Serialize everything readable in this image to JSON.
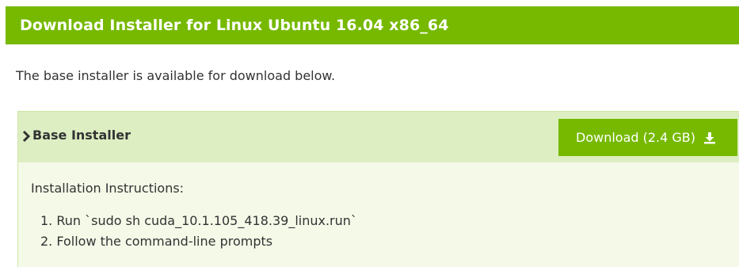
{
  "header": {
    "title": "Download Installer for Linux Ubuntu 16.04 x86_64"
  },
  "intro_text": "The base installer is available for download below.",
  "installer_panel": {
    "title": "Base Installer",
    "chevron_icon": "chevron-right-icon",
    "download_button": {
      "label": "Download (2.4 GB)",
      "icon": "download-icon"
    },
    "instructions_label": "Installation Instructions:",
    "steps": [
      "1. Run `sudo sh cuda_10.1.105_418.39_linux.run`",
      "2. Follow the command-line prompts"
    ]
  },
  "colors": {
    "accent_green": "#76b900",
    "panel_header_bg": "#ddeec2",
    "panel_body_bg": "#f4f9e8",
    "text": "#333333"
  }
}
